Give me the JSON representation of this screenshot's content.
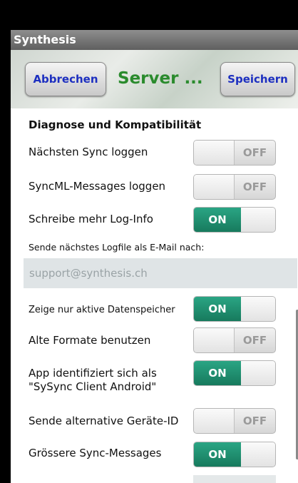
{
  "app": {
    "title": "Synthesis"
  },
  "actionbar": {
    "cancel_label": "Abbrechen",
    "title": "Server ...",
    "save_label": "Speichern"
  },
  "section": {
    "title": "Diagnose und Kompatibilität"
  },
  "settings": [
    {
      "label": "Nächsten Sync loggen",
      "state": "OFF"
    },
    {
      "label": "SyncML-Messages loggen",
      "state": "OFF"
    },
    {
      "label": "Schreibe mehr Log-Info",
      "state": "ON"
    }
  ],
  "email": {
    "label": "Sende nächstes Logfile als E-Mail nach:",
    "value": "support@synthesis.ch"
  },
  "settings2": [
    {
      "label": "Zeige nur aktive Datenspeicher",
      "state": "ON"
    },
    {
      "label": "Alte Formate benutzen",
      "state": "OFF"
    },
    {
      "label": "App identifiziert sich als\n\"SySync Client Android\"",
      "state": "ON"
    },
    {
      "label": "Sende alternative Geräte-ID",
      "state": "OFF"
    },
    {
      "label": "Grössere Sync-Messages",
      "state": "ON"
    }
  ],
  "colors": {
    "accent_green": "#2a8b2d",
    "toggle_on": "#1f8f6f",
    "button_text": "#1d2fc0"
  }
}
